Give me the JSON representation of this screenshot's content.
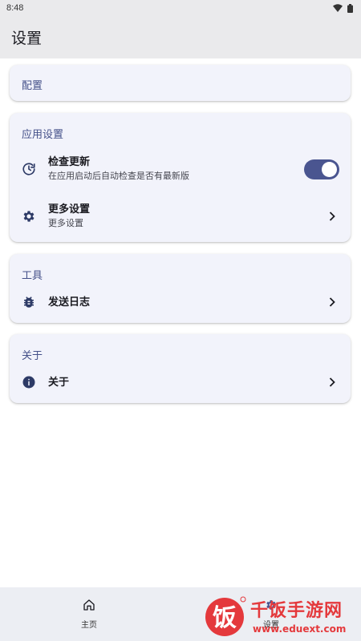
{
  "status_bar": {
    "time": "8:48"
  },
  "app_bar": {
    "title": "设置"
  },
  "cards": {
    "config": {
      "title": "配置"
    },
    "app_settings": {
      "title": "应用设置",
      "check_update": {
        "title": "检查更新",
        "subtitle": "在应用启动后自动检查是否有最新版",
        "toggle_on": true
      },
      "more_settings": {
        "title": "更多设置",
        "subtitle": "更多设置"
      }
    },
    "tools": {
      "title": "工具",
      "send_log": {
        "title": "发送日志"
      }
    },
    "about": {
      "title": "关于",
      "about_item": {
        "title": "关于"
      }
    }
  },
  "bottom_nav": {
    "home": {
      "label": "主页",
      "icon": "home-icon"
    },
    "settings": {
      "label": "设置",
      "icon": "settings-icon"
    }
  },
  "watermark": {
    "text": "千饭手游网",
    "url": "www.eduext.com",
    "logo_char": "饭"
  },
  "colors": {
    "accent": "#4a5590",
    "card_bg": "#f2f3fb",
    "section_title": "#445089",
    "watermark": "#e4393c"
  }
}
